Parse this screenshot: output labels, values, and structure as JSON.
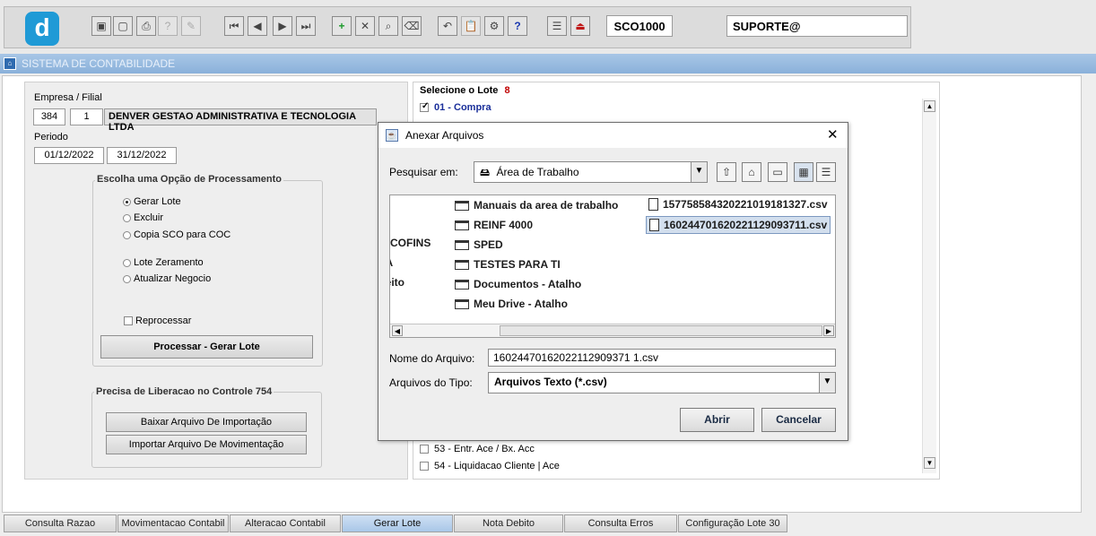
{
  "toolbar": {
    "program_code": "SCO1000",
    "user": "SUPORTE@",
    "app_logo_letter": "d"
  },
  "window": {
    "title": "SISTEMA DE CONTABILIDADE"
  },
  "empresa": {
    "label": "Empresa / Filial",
    "empresa": "384",
    "filial": "1",
    "nome": "DENVER GESTAO ADMINISTRATIVA E TECNOLOGIA LTDA"
  },
  "periodo": {
    "label": "Periodo",
    "inicio": "01/12/2022",
    "fim": "31/12/2022"
  },
  "opcao": {
    "title": "Escolha uma Opção de Processamento",
    "options": [
      "Gerar Lote",
      "Excluir",
      "Copia SCO para COC",
      "Lote Zeramento",
      "Atualizar Negocio"
    ],
    "selected": "Gerar Lote",
    "reprocessar_label": "Reprocessar",
    "processar_button": "Processar - Gerar Lote"
  },
  "liberacao": {
    "title": "Precisa de Liberacao no Controle 754",
    "baixar_button": "Baixar Arquivo De Importação",
    "importar_button": "Importar Arquivo De Movimentação"
  },
  "lote": {
    "title": "Selecione o Lote",
    "count": "8",
    "items": [
      {
        "label": "01 - Compra",
        "checked": true
      },
      {
        "label": "53 - Entr. Ace / Bx. Acc",
        "checked": false
      },
      {
        "label": "54 - Liquidacao Cliente | Ace",
        "checked": false
      }
    ]
  },
  "tabs": [
    "Consulta Razao",
    "Movimentacao Contabil",
    "Alteracao Contabil",
    "Gerar Lote",
    "Nota Debito",
    "Consulta Erros",
    "Configuração Lote 30"
  ],
  "active_tab": "Gerar Lote",
  "dialog": {
    "title": "Anexar Arquivos",
    "lookin_label": "Pesquisar em:",
    "lookin_value": "Área de Trabalho",
    "partial_items": [
      "S-COFINS",
      "TA",
      "ceito"
    ],
    "folders": [
      "Manuais da area de trabalho",
      "REINF 4000",
      "SPED",
      "TESTES PARA TI",
      "Documentos - Atalho",
      "Meu Drive - Atalho"
    ],
    "files": [
      "15775858432022101918132 7.csv",
      "16024470162022112909371 1.csv"
    ],
    "file_items": [
      "1577585843202210191813 27.csv",
      "1602447016202211290937 11.csv"
    ],
    "file_name_label": "Nome do Arquivo:",
    "file_name_value": "16024470162022112909371 1.csv",
    "file_type_label": "Arquivos do Tipo:",
    "file_type_value": "Arquivos Texto (*.csv)",
    "open_button": "Abrir",
    "cancel_button": "Cancelar"
  }
}
